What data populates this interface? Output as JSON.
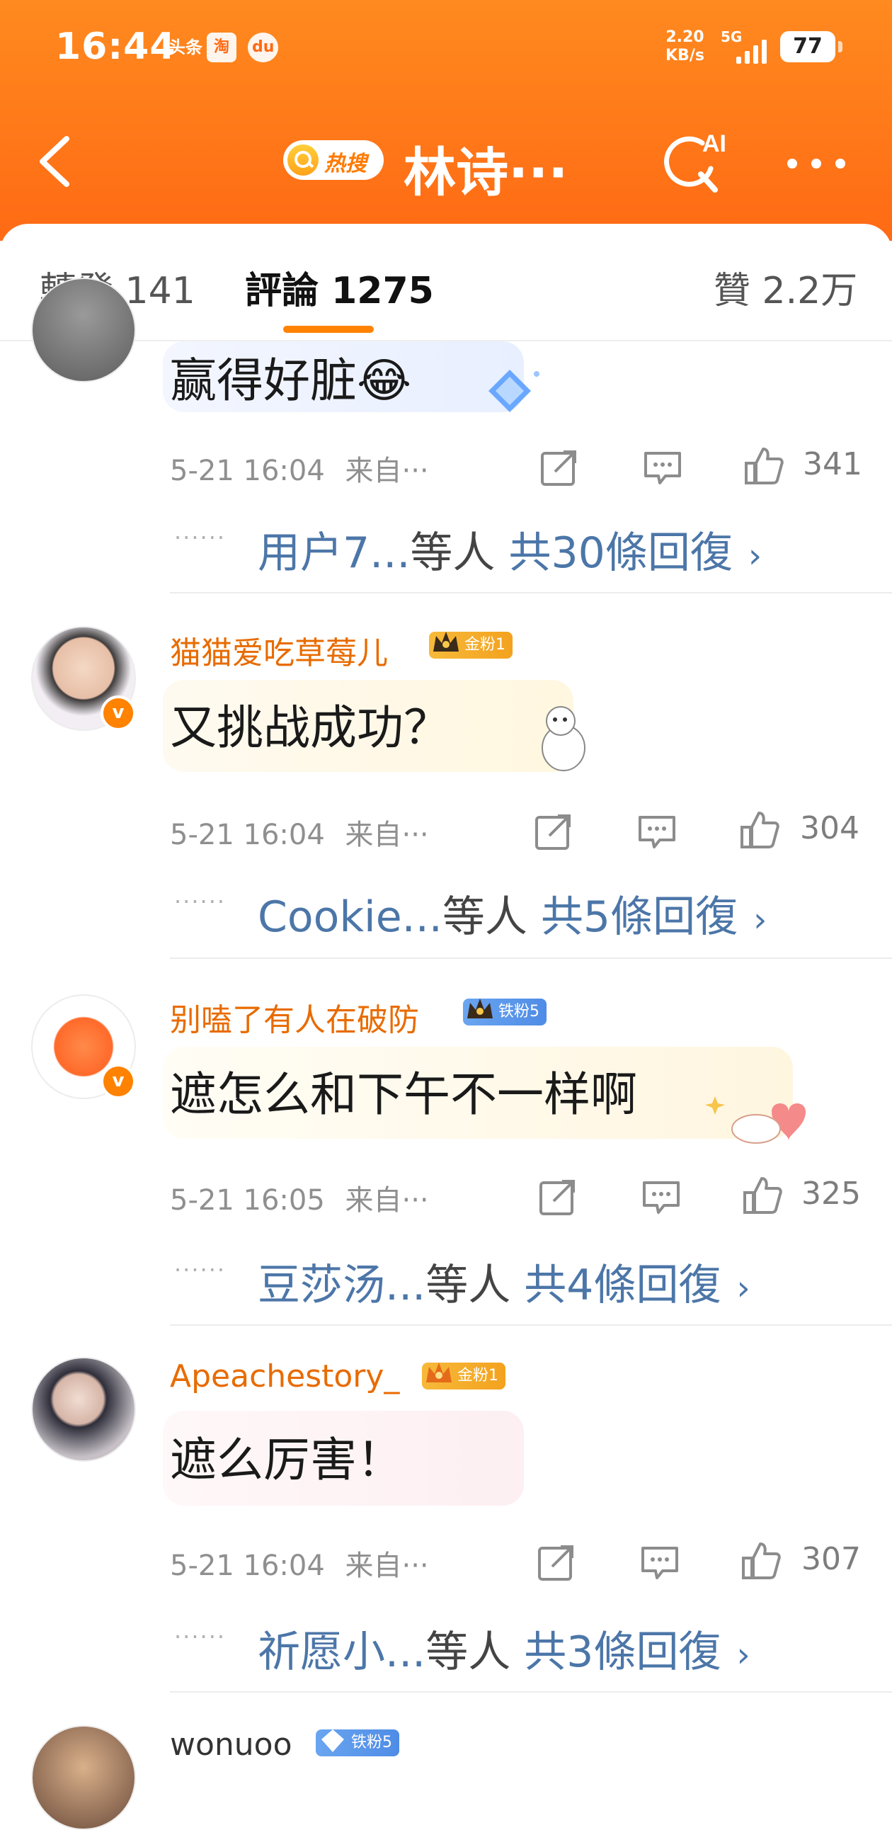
{
  "status_bar": {
    "time": "16:44",
    "app_icons": [
      "头条",
      "淘",
      "du"
    ],
    "net_speed_value": "2.20",
    "net_speed_unit": "KB/s",
    "network": "5G",
    "battery": "77"
  },
  "header": {
    "hot_search_label": "热搜",
    "title": "林诗···"
  },
  "tabs": [
    {
      "label": "轉發 141"
    },
    {
      "label": "評論 1275"
    },
    {
      "label": "贊 2.2万"
    }
  ],
  "comments": [
    {
      "text": "赢得好脏😂",
      "time": "5-21 16:04",
      "source": "来自···",
      "likes": "341",
      "reply_users": "用户7...",
      "reply_mid": "等人",
      "reply_total": "共30條回復"
    },
    {
      "username": "猫猫爱吃草莓儿",
      "fan_badge": "金粉1",
      "text": "又挑战成功？",
      "time": "5-21 16:04",
      "source": "来自···",
      "likes": "304",
      "reply_users": "Cookie...",
      "reply_mid": "等人",
      "reply_total": "共5條回復"
    },
    {
      "username": "别嗑了有人在破防",
      "fan_badge": "铁粉5",
      "text": "遮怎么和下午不一样啊",
      "time": "5-21 16:05",
      "source": "来自···",
      "likes": "325",
      "reply_users": "豆莎汤...",
      "reply_mid": "等人",
      "reply_total": "共4條回復"
    },
    {
      "username": "Apeachestory_",
      "fan_badge": "金粉1",
      "text": "遮么厉害！",
      "time": "5-21 16:04",
      "source": "来自···",
      "likes": "307",
      "reply_users": "祈愿小...",
      "reply_mid": "等人",
      "reply_total": "共3條回復"
    },
    {
      "username": "wonuoo",
      "fan_badge": "铁粉5"
    }
  ],
  "reply_dots": "······",
  "colors": {
    "accent": "#ff8200",
    "header_start": "#ff8a1f",
    "username": "#e86b00",
    "link": "#4c76a8",
    "gold_badge": "#f3a21e",
    "iron_badge": "#4f8ce6"
  }
}
